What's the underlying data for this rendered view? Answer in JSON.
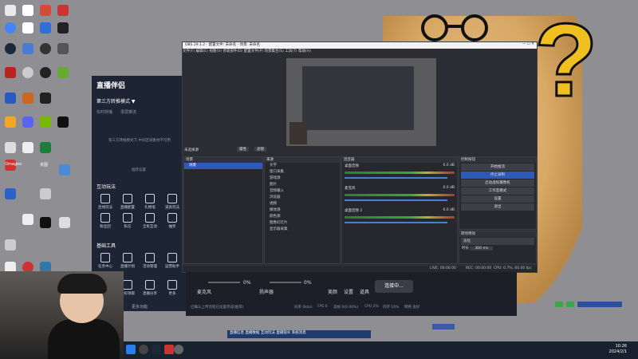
{
  "desktop": {
    "icons": [
      {
        "name": "icon-1",
        "color": "#e9e9e9"
      },
      {
        "name": "icon-2",
        "color": "#ffffff"
      },
      {
        "name": "icon-3",
        "color": "#d64a3a"
      },
      {
        "name": "chrome",
        "color": "#4285f4"
      },
      {
        "name": "doc",
        "color": "#ffffff"
      },
      {
        "name": "game",
        "color": "#2f6fd6"
      },
      {
        "name": "steam",
        "color": "#1b2838"
      },
      {
        "name": "discord",
        "color": "#5865f2"
      },
      {
        "name": "nvidia",
        "color": "#76b900"
      }
    ],
    "labels": [
      "Omagoo",
      "夹图"
    ]
  },
  "helper_app": {
    "title": "直播伴侣",
    "mode": "第三方转推模式 ▼",
    "tabs": [
      "实时转播",
      "录屏推流"
    ],
    "hint": "第三方转推模式下,中间区域素材不可用",
    "tip": "推荐设置",
    "section_interactive": "互动玩法",
    "interactive_buttons": [
      "连线玩法",
      "直播配置",
      "礼物墙",
      "道具玩法",
      "粉丝团",
      "私信",
      "全民互动",
      "抽奖"
    ],
    "section_tools": "基础工具",
    "tool_buttons": [
      "任务中心",
      "直播计划",
      "活动管理",
      "运营助手",
      "直播数据",
      "特权领取",
      "直播分享",
      "更多"
    ],
    "more": "更多功能"
  },
  "obs": {
    "window_title": "OBS 29.1.2 - 配置文件: 未命名 - 场景: 未命名",
    "menu": [
      "文件(F)",
      "编辑(E)",
      "视图(V)",
      "停靠部件(D)",
      "配置文件(P)",
      "场景集合(S)",
      "工具(T)",
      "帮助(H)"
    ],
    "no_source": "未选择源",
    "props_btn": "属性",
    "filters_btn": "滤镜",
    "scenes": {
      "title": "场景",
      "items": [
        "场景"
      ]
    },
    "sources": {
      "title": "来源",
      "items": [
        "文字",
        "窗口采集",
        "游戏源",
        "图片",
        "音频输入",
        "浏览器",
        "视频",
        "媒体源",
        "颜色源",
        "图像幻灯片",
        "显示器采集"
      ]
    },
    "mixer": {
      "title": "混音器",
      "tracks": [
        {
          "name": "桌面音频",
          "db": "0.0 dB"
        },
        {
          "name": "麦克风",
          "db": "0.0 dB"
        },
        {
          "name": "桌面音频 2",
          "db": "0.0 dB"
        }
      ]
    },
    "controls": {
      "title": "控制按钮",
      "buttons": [
        "开始推流",
        "停止录制",
        "启动虚拟摄像机",
        "工作室模式",
        "设置",
        "退出"
      ]
    },
    "transitions": {
      "title": "转场特效",
      "type": "淡化",
      "duration_label": "时长",
      "duration": "300 ms"
    },
    "status": {
      "live": "LIVE: 00:00:00",
      "rec": "REC: 00:00:00",
      "cpu": "CPU: 0.7%, 60.00 fps"
    }
  },
  "livebar": {
    "mic_label": "麦克风",
    "mic_pct": "0%",
    "speaker_label": "扬声器",
    "speaker_pct": "0%",
    "icons": [
      "美颜",
      "设置",
      "道具"
    ],
    "go_live": "连接中...",
    "notice": "已确认上传流程已设置完成(推荐)",
    "stats": [
      "码率 0kb/s",
      "FPS 0",
      "丢帧 0(0.00%)",
      "CPU 2%",
      "内存 16%",
      "网络 良好"
    ]
  },
  "taskbar": {
    "time": "10:26",
    "date": "2024/2/1",
    "mini_items": [
      "直播信息",
      "直播数据",
      "互动玩法",
      "直播观众",
      "系统消息"
    ]
  }
}
